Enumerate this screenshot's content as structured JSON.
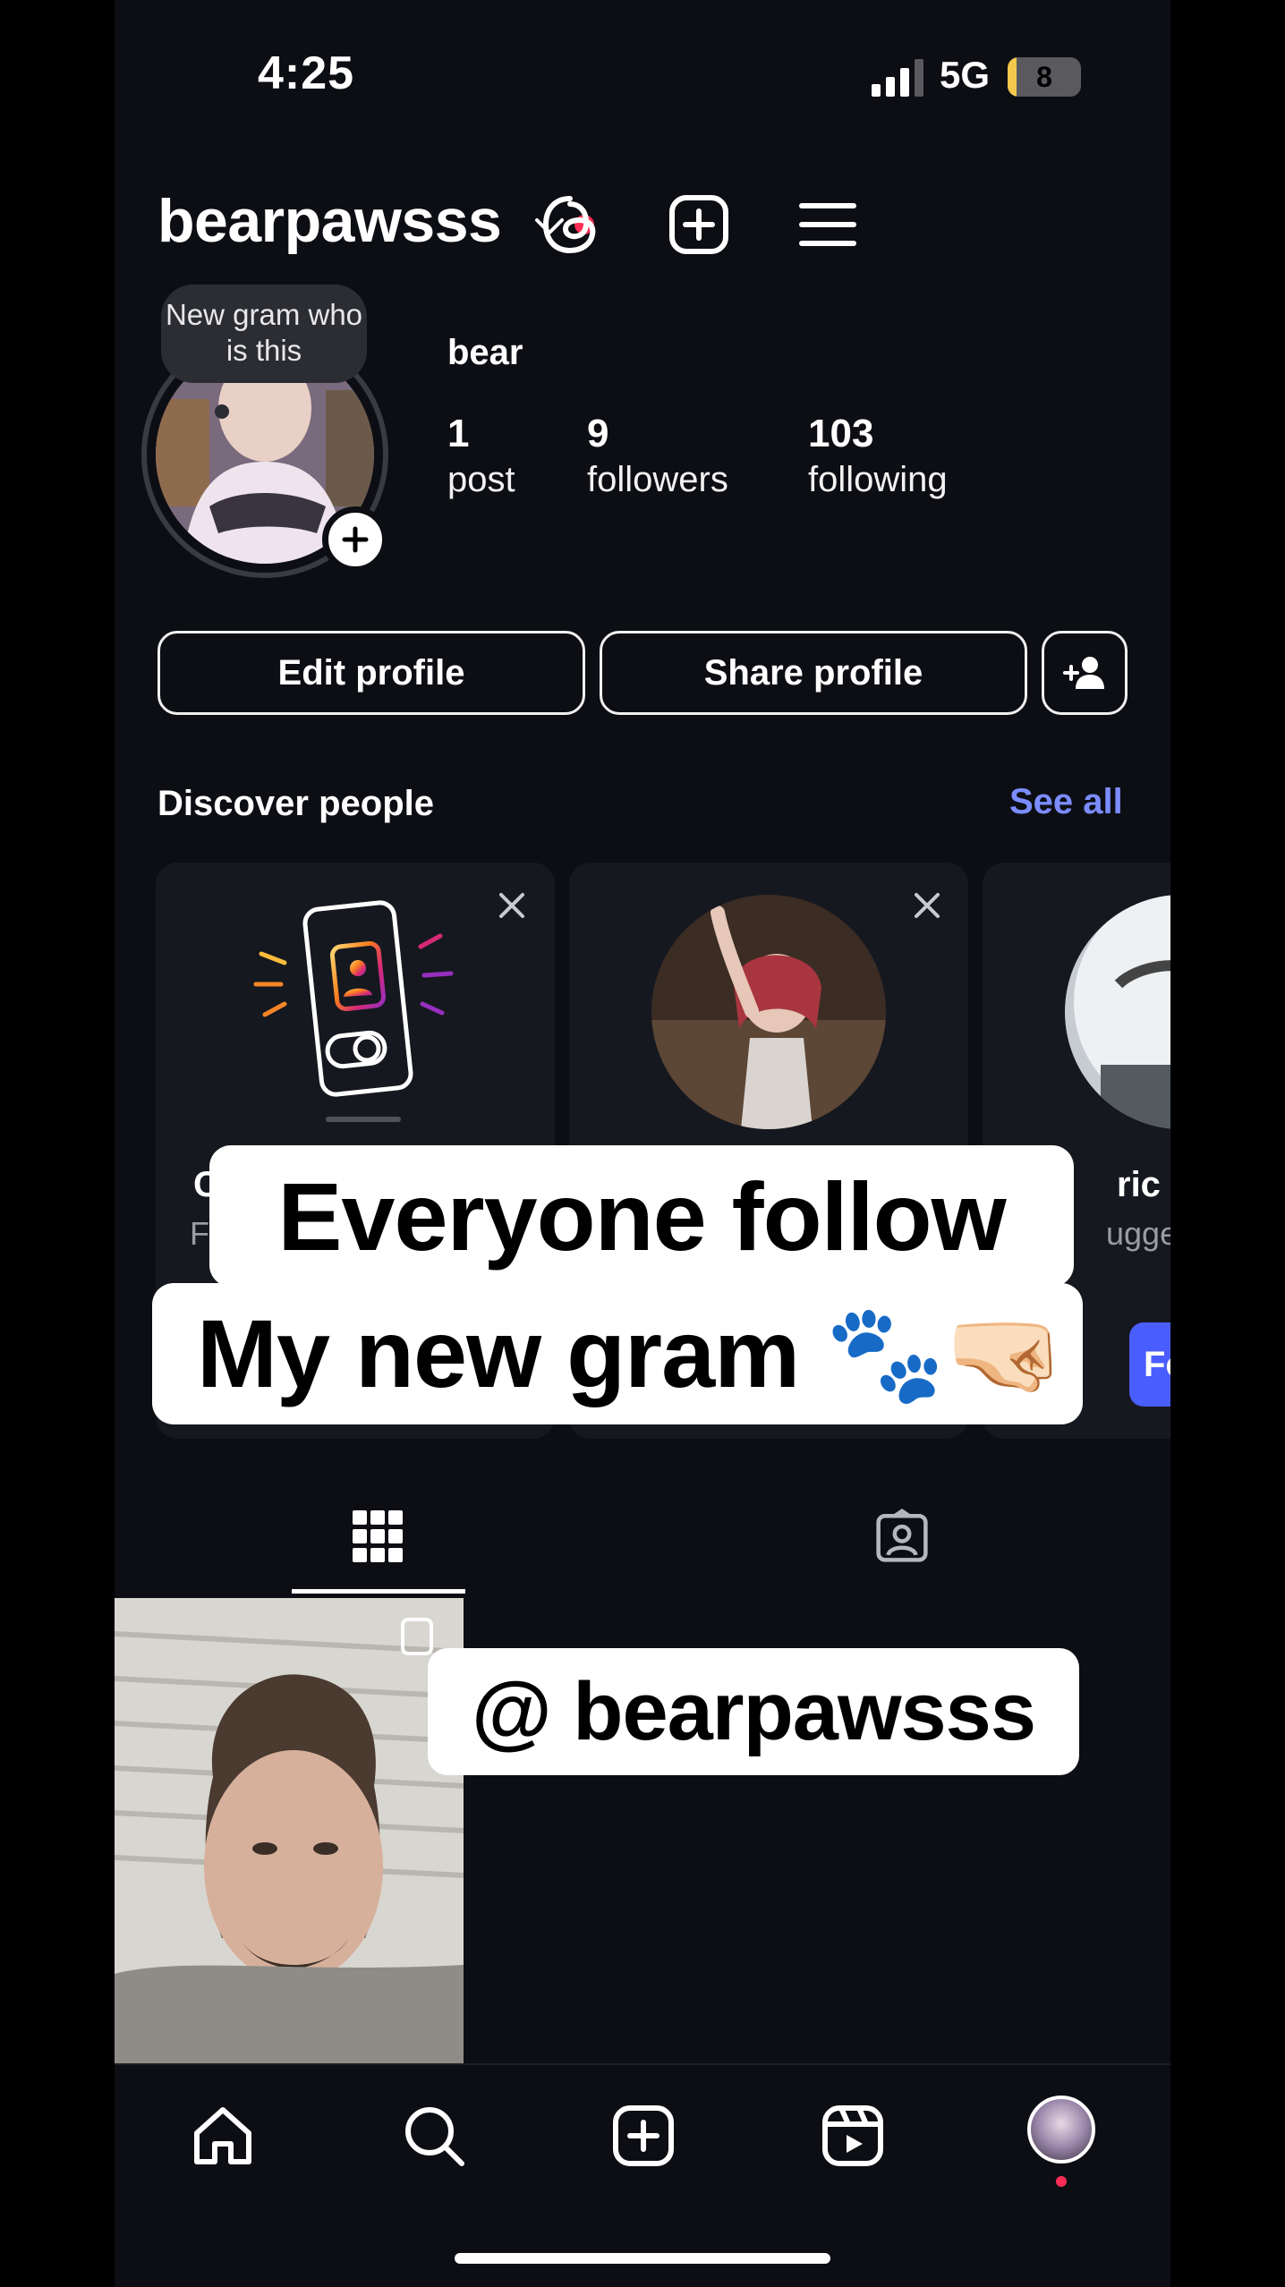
{
  "status_bar": {
    "time": "4:25",
    "network": "5G",
    "battery": "8",
    "battery_level": 0.08
  },
  "header": {
    "username": "bearpawsss",
    "icons": [
      "threads-icon",
      "create-post-icon",
      "menu-icon"
    ]
  },
  "profile": {
    "note": "New gram who is this",
    "display_name": "bear",
    "stats": [
      {
        "value": "1",
        "label": "post"
      },
      {
        "value": "9",
        "label": "followers"
      },
      {
        "value": "103",
        "label": "following"
      }
    ]
  },
  "buttons": {
    "edit": "Edit profile",
    "share": "Share profile"
  },
  "discover": {
    "title": "Discover people",
    "see_all": "See all",
    "cards": [
      {
        "name_frag": "C",
        "sub_frag": "F"
      },
      {
        "name_frag": "",
        "sub_frag": ""
      },
      {
        "name_frag": "ric",
        "sub_frag": "uggest",
        "follow_frag": "Fo"
      }
    ]
  },
  "captions": {
    "line1": "Everyone follow",
    "line2": "My new gram 🐾🤜🏻",
    "handle": "@ bearpawsss"
  },
  "colors": {
    "accent_link": "#7b8cff",
    "follow_button": "#4a5dff",
    "notification_dot": "#ff2d55",
    "background": "#0c0e13"
  }
}
